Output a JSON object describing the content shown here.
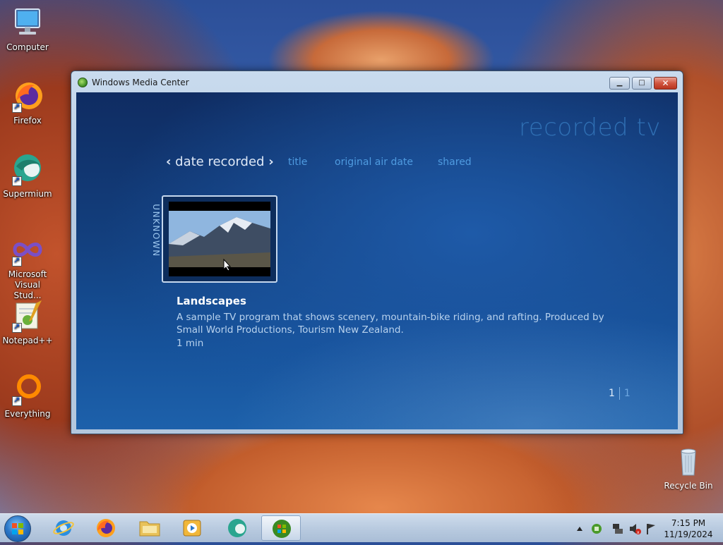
{
  "desktop": {
    "icons": [
      {
        "label": "Computer",
        "icon": "computer-icon"
      },
      {
        "label": "Firefox",
        "icon": "firefox-icon"
      },
      {
        "label": "Supermium",
        "icon": "supermium-icon"
      },
      {
        "label": "Microsoft Visual Stud...",
        "icon": "visual-studio-icon"
      },
      {
        "label": "Notepad++",
        "icon": "notepadpp-icon"
      },
      {
        "label": "Everything",
        "icon": "everything-icon"
      }
    ],
    "recycle_bin": {
      "label": "Recycle Bin",
      "icon": "recycle-bin-icon"
    }
  },
  "window": {
    "title": "Windows Media Center",
    "buttons": {
      "minimize": "minimize-icon",
      "maximize": "maximize-icon",
      "close": "close-icon"
    }
  },
  "media_center": {
    "section_title": "recorded tv",
    "sort_tabs": {
      "active": "date recorded",
      "others": [
        "title",
        "original air date",
        "shared"
      ]
    },
    "group_label": "UNKNOWN",
    "program": {
      "title": "Landscapes",
      "description": "A sample TV program that shows scenery, mountain-bike riding, and rafting. Produced by Small World Productions, Tourism New Zealand.",
      "duration": "1 min"
    },
    "pager": {
      "current": "1",
      "total": "1"
    }
  },
  "taskbar": {
    "items": [
      {
        "name": "internet-explorer",
        "icon": "ie-icon"
      },
      {
        "name": "firefox",
        "icon": "firefox-icon"
      },
      {
        "name": "file-explorer",
        "icon": "folder-icon"
      },
      {
        "name": "media-player",
        "icon": "media-player-icon"
      },
      {
        "name": "supermium",
        "icon": "supermium-icon"
      },
      {
        "name": "windows-media-center",
        "icon": "media-center-icon",
        "active": true
      }
    ],
    "tray": {
      "time": "7:15 PM",
      "date": "11/19/2024"
    }
  }
}
